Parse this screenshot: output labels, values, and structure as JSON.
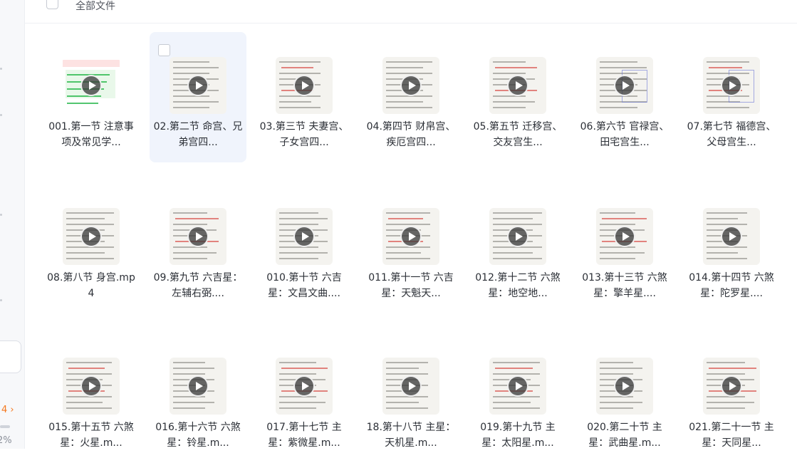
{
  "header": {
    "title": "全部文件"
  },
  "files": [
    {
      "name": "001.第一节 注意事项及常见学..."
    },
    {
      "name": "02.第二节 命宫、兄弟宫四..."
    },
    {
      "name": "03.第三节 夫妻宫、子女宫四..."
    },
    {
      "name": "04.第四节 财帛宫、疾厄宫四..."
    },
    {
      "name": "05.第五节 迁移宫、交友宫生..."
    },
    {
      "name": "06.第六节 官禄宫、田宅宫生..."
    },
    {
      "name": "07.第七节 福德宫、父母宫生..."
    },
    {
      "name": "08.第八节 身宫.mp4"
    },
    {
      "name": "09.第九节 六吉星：左辅右弼...."
    },
    {
      "name": "010.第十节 六吉星：文昌文曲...."
    },
    {
      "name": "011.第十一节 六吉星：天魁天..."
    },
    {
      "name": "012.第十二节 六煞星：地空地..."
    },
    {
      "name": "013.第十三节 六煞星：擎羊星...."
    },
    {
      "name": "014.第十四节 六煞星：陀罗星...."
    },
    {
      "name": "015.第十五节 六煞星：火星.m..."
    },
    {
      "name": "016.第十六节 六煞星：铃星.m..."
    },
    {
      "name": "017.第十七节 主星：紫微星.m..."
    },
    {
      "name": "18.第十八节 主星：天机星.m..."
    },
    {
      "name": "019.第十九节 主星：太阳星.m..."
    },
    {
      "name": "020.第二十节 主星：武曲星.m..."
    },
    {
      "name": "021.第二十一节 主星：天同星..."
    }
  ],
  "icons": {
    "play": "play-icon",
    "checkbox": "checkbox-icon"
  },
  "colors": {
    "selected_bg": "#f0f4fc",
    "accent": "#f5781e"
  }
}
